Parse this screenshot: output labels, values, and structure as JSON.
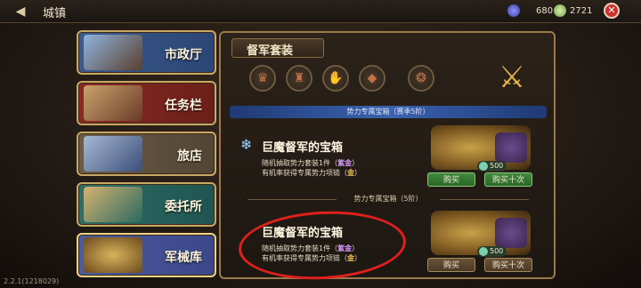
{
  "topbar": {
    "title": "城镇",
    "currency1": "680",
    "currency2": "2721",
    "close_label": "✕"
  },
  "menu": {
    "items": [
      {
        "label": "市政厅"
      },
      {
        "label": "任务栏"
      },
      {
        "label": "旅店"
      },
      {
        "label": "委托所"
      },
      {
        "label": "军械库"
      }
    ]
  },
  "panel": {
    "title": "督军套装",
    "season_divider": "势力专属宝箱（赛季5阶）",
    "plain_divider": "势力专属宝箱（5阶）",
    "chests": [
      {
        "name": "巨魔督军的宝箱",
        "desc1_pre": "随机抽取势力套装1件（",
        "desc1_hl": "紫金",
        "desc1_post": "）",
        "desc2_pre": "有机率获得专属势力项链（",
        "desc2_hl": "金",
        "desc2_post": "）",
        "price": "500",
        "buy": "购买",
        "buy10": "购买十次"
      },
      {
        "name": "巨魔督军的宝箱",
        "desc1_pre": "随机抽取势力套装1件（",
        "desc1_hl": "紫金",
        "desc1_post": "）",
        "desc2_pre": "有机率获得专属势力项链（",
        "desc2_hl": "金",
        "desc2_post": "）",
        "price": "500",
        "buy": "购买",
        "buy10": "购买十次"
      }
    ]
  },
  "version": "2.2.1(1218029)",
  "colors": {
    "accent_gold": "#c9a865",
    "annotation_red": "#e0201c"
  }
}
